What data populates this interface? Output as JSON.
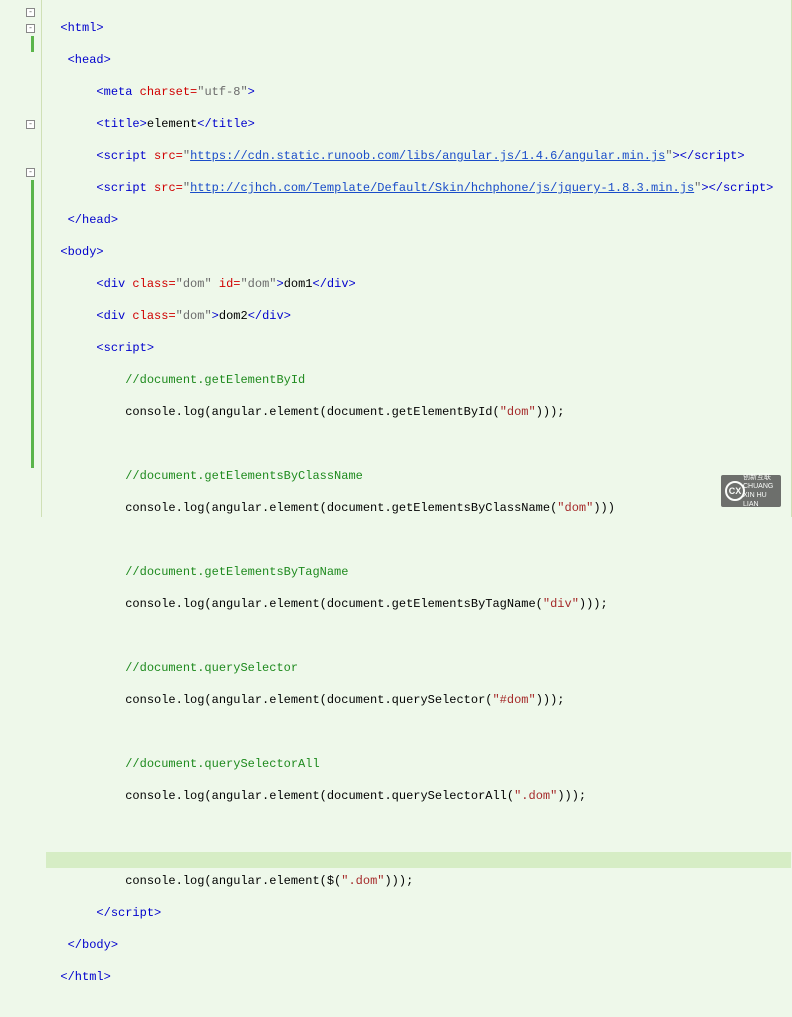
{
  "gutter": {
    "fold_open": "-",
    "bars": [
      3,
      12,
      29
    ]
  },
  "code": {
    "l1": {
      "indent": "  ",
      "tag_open": "<html>",
      "fold": true
    },
    "l2": {
      "indent": "   ",
      "tag_open": "<head>",
      "fold": true
    },
    "l3": {
      "indent": "       ",
      "tag": "<meta",
      "attr": " charset=",
      "val": "\"utf-8\"",
      "close": ">"
    },
    "l4": {
      "indent": "       ",
      "open": "<title>",
      "txt": "element",
      "close": "</title>"
    },
    "l5": {
      "indent": "       ",
      "open": "<script",
      "attr": " src=",
      "q": "\"",
      "url": "https://cdn.static.runoob.com/libs/angular.js/1.4.6/angular.min.js",
      "q2": "\"",
      "mid": ">",
      "close": "</script>"
    },
    "l6": {
      "indent": "       ",
      "open": "<script",
      "attr": " src=",
      "q": "\"",
      "url": "http://cjhch.com/Template/Default/Skin/hchphone/js/jquery-1.8.3.min.js",
      "q2": "\"",
      "mid": ">",
      "close": "</script>"
    },
    "l7": {
      "indent": "   ",
      "tag": "</head>"
    },
    "l8": {
      "indent": "  ",
      "tag": "<body>",
      "fold": true
    },
    "l9": {
      "indent": "       ",
      "open": "<div",
      "attr1": " class=",
      "v1": "\"dom\"",
      "attr2": " id=",
      "v2": "\"dom\"",
      "mid": ">",
      "txt": "dom1",
      "close": "</div>"
    },
    "l10": {
      "indent": "       ",
      "open": "<div",
      "attr1": " class=",
      "v1": "\"dom\"",
      "mid": ">",
      "txt": "dom2",
      "close": "</div>"
    },
    "l11": {
      "indent": "       ",
      "tag": "<script>",
      "fold": true
    },
    "l12": {
      "indent": "           ",
      "cmt": "//document.getElementById"
    },
    "l13": {
      "indent": "           ",
      "p1": "console.log(angular.element(document.getElementById(",
      "s": "\"dom\"",
      "p2": ")));"
    },
    "l14": {
      "indent": ""
    },
    "l15": {
      "indent": "           ",
      "cmt": "//document.getElementsByClassName"
    },
    "l16": {
      "indent": "           ",
      "p1": "console.log(angular.element(document.getElementsByClassName(",
      "s": "\"dom\"",
      "p2": ")))"
    },
    "l17": {
      "indent": ""
    },
    "l18": {
      "indent": "           ",
      "cmt": "//document.getElementsByTagName"
    },
    "l19": {
      "indent": "           ",
      "p1": "console.log(angular.element(document.getElementsByTagName(",
      "s": "\"div\"",
      "p2": ")));"
    },
    "l20": {
      "indent": ""
    },
    "l21": {
      "indent": "           ",
      "cmt": "//document.querySelector"
    },
    "l22": {
      "indent": "           ",
      "p1": "console.log(angular.element(document.querySelector(",
      "s": "\"#dom\"",
      "p2": ")));"
    },
    "l23": {
      "indent": ""
    },
    "l24": {
      "indent": "           ",
      "cmt": "//document.querySelectorAll"
    },
    "l25": {
      "indent": "           ",
      "p1": "console.log(angular.element(document.querySelectorAll(",
      "s": "\".dom\"",
      "p2": ")));"
    },
    "l26": {
      "indent": ""
    },
    "l27": {
      "highlight": true
    },
    "l28": {
      "indent": "           ",
      "p1": "console.log(angular.element($(",
      "s": "\".dom\"",
      "p2": ")));"
    },
    "l29": {
      "indent": "       ",
      "tag": "</script>"
    },
    "l30": {
      "indent": "   ",
      "tag": "</body>"
    },
    "l31": {
      "indent": "  ",
      "tag": "</html>"
    }
  },
  "watermark": {
    "symbol": "CX",
    "text1": "创新互联",
    "text2": "CHUANG XIN HU LIAN"
  }
}
